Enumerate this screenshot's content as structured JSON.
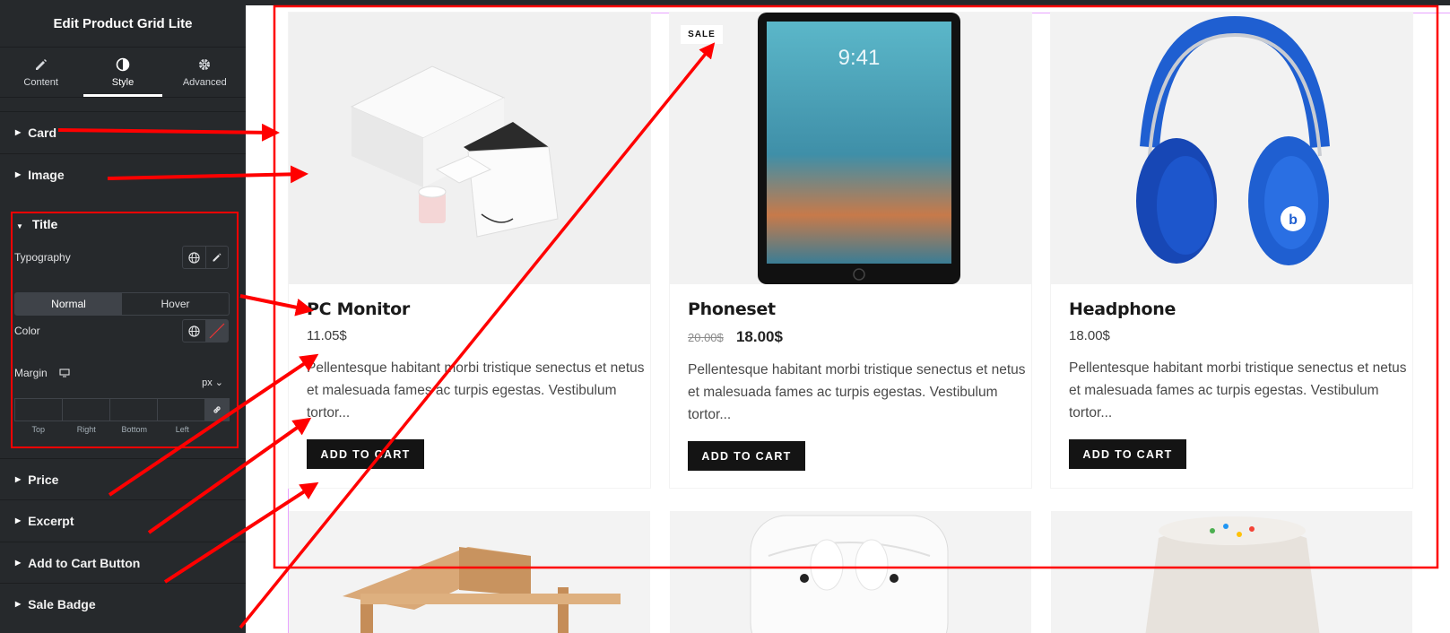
{
  "sidebar": {
    "header": "Edit Product Grid Lite",
    "tabs": [
      {
        "label": "Content",
        "icon": "pencil-icon"
      },
      {
        "label": "Style",
        "icon": "contrast-icon"
      },
      {
        "label": "Advanced",
        "icon": "gear-icon"
      }
    ],
    "sections": {
      "card": "Card",
      "image": "Image",
      "title": "Title",
      "price": "Price",
      "excerpt": "Excerpt",
      "add_to_cart": "Add to Cart Button",
      "sale_badge": "Sale Badge"
    },
    "title_panel": {
      "typography": "Typography",
      "normal": "Normal",
      "hover": "Hover",
      "color": "Color",
      "margin": "Margin",
      "unit": "px",
      "margin_labels": [
        "Top",
        "Right",
        "Bottom",
        "Left"
      ]
    }
  },
  "products": [
    {
      "title": "PC Monitor",
      "price": "11.05$",
      "excerpt": "Pellentesque habitant morbi tristique senectus et netus et malesuada fames ac turpis egestas. Vestibulum tortor...",
      "button": "ADD TO CART"
    },
    {
      "title": "Phoneset",
      "old_price": "20.00$",
      "price": "18.00$",
      "badge": "SALE",
      "excerpt": "Pellentesque habitant morbi tristique senectus et netus et malesuada fames ac turpis egestas. Vestibulum tortor...",
      "button": "ADD TO CART"
    },
    {
      "title": "Headphone",
      "price": "18.00$",
      "excerpt": "Pellentesque habitant morbi tristique senectus et netus et malesuada fames ac turpis egestas. Vestibulum tortor...",
      "button": "ADD TO CART"
    }
  ],
  "colors": {
    "annotation": "#ff0000",
    "sidebar_bg": "#26292c",
    "button_bg": "#141414"
  }
}
